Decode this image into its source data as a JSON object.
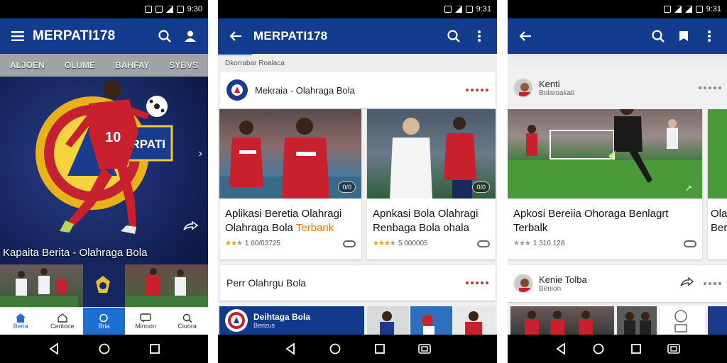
{
  "screens": [
    {
      "status_time": "9:30",
      "app_title": "MERPATI178",
      "tabs": [
        "ALJOEN",
        "OLUME",
        "BAHFAY",
        "SYBVS"
      ],
      "hero_caption": "Kapaita Berita - Olahraga Bola",
      "hero_crest_text": "MERPATI",
      "bottom_nav": [
        "Beria",
        "Centoce",
        "Bria",
        "Minoon",
        "Ciuora"
      ]
    },
    {
      "status_time": "9:31",
      "app_title": "MERPATI178",
      "section_label": "Dkorrabar Roalaca",
      "card1_name": "Mekraia - Olahraga Bola",
      "tile1": {
        "title": "Aplikasi Beretia Olahragi Olahraga Bola Terbank",
        "highlight": "Terbank",
        "rating": "4.6",
        "meta": "1 60/03725"
      },
      "tile2": {
        "title": "Apnkasi Bola Olahragi Renbaga Bola ohala",
        "rating": "4.5",
        "meta": "5 000005"
      },
      "card2_name": "Perr Olahrgu Bola",
      "banner_title": "Deihtaga Bola",
      "banner_sub": "Berizus"
    },
    {
      "status_time": "9:31",
      "profile_name": "Kenti",
      "profile_sub": "Bolaroakati",
      "tile3": {
        "title": "Apkosi Bereiia Ohoraga Benlagrt Terbalk",
        "meta": "1 310.128"
      },
      "tile4_title_partial": "Ola Ber",
      "profile2_name": "Kenie Tolba",
      "profile2_sub": "Benion"
    }
  ],
  "colors": {
    "brand_blue": "#133c8e",
    "active_blue": "#1a6fd0",
    "jersey_red": "#c8202d",
    "accent_orange": "#e07b10"
  }
}
